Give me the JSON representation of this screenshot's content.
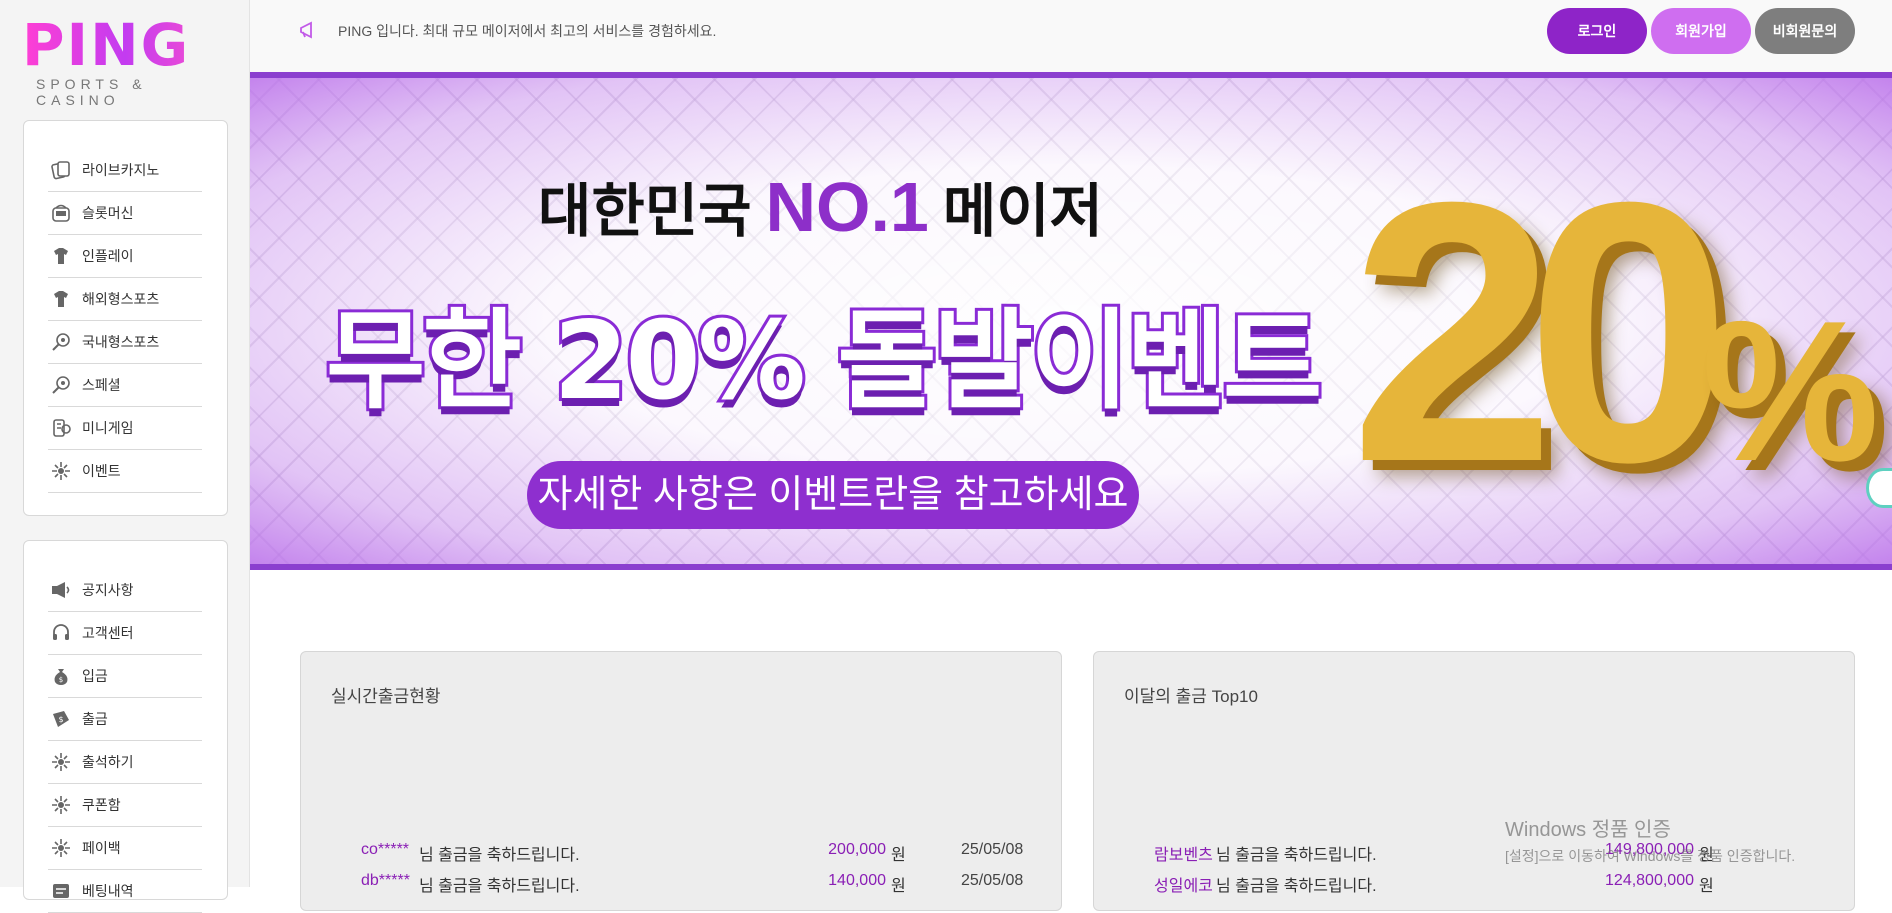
{
  "brand": {
    "logo": "PING",
    "tagline": "SPORTS & CASINO"
  },
  "sidebar": {
    "menu1": [
      {
        "label": "라이브카지노",
        "icon": "cards-icon"
      },
      {
        "label": "슬롯머신",
        "icon": "slot-machine-icon"
      },
      {
        "label": "인플레이",
        "icon": "sports-jersey-icon"
      },
      {
        "label": "해외형스포츠",
        "icon": "sports-jersey-icon"
      },
      {
        "label": "국내형스포츠",
        "icon": "sports-ball-icon"
      },
      {
        "label": "스페셜",
        "icon": "sports-ball-icon"
      },
      {
        "label": "미니게임",
        "icon": "minigame-icon"
      },
      {
        "label": "이벤트",
        "icon": "sparkle-icon"
      }
    ],
    "menu2": [
      {
        "label": "공지사항",
        "icon": "megaphone-icon"
      },
      {
        "label": "고객센터",
        "icon": "headset-icon"
      },
      {
        "label": "입금",
        "icon": "money-bag-icon"
      },
      {
        "label": "출금",
        "icon": "withdraw-icon"
      },
      {
        "label": "출석하기",
        "icon": "sparkle-icon"
      },
      {
        "label": "쿠폰함",
        "icon": "sparkle-icon"
      },
      {
        "label": "페이백",
        "icon": "sparkle-icon"
      },
      {
        "label": "베팅내역",
        "icon": "list-icon"
      }
    ]
  },
  "topbar": {
    "notice": "PING 입니다. 최대 규모 메이저에서 최고의 서비스를 경험하세요.",
    "login": "로그인",
    "join": "회원가입",
    "guest_inquiry": "비회원문의"
  },
  "banner": {
    "line1_pre": "대한민국",
    "line1_no1": "NO.1",
    "line1_post": "메이저",
    "line2": "무한 20% 돌발이벤트",
    "pill": "자세한 사항은 이벤트란을 참고하세요",
    "big_number": "20",
    "big_pct": "%"
  },
  "panels": {
    "realtime": {
      "title": "실시간출금현황",
      "rows": [
        {
          "user": "co*****",
          "msg": "님 출금을 축하드립니다.",
          "amount": "200,000",
          "unit": "원",
          "date": "25/05/08"
        },
        {
          "user": "db*****",
          "msg": "님 출금을 축하드립니다.",
          "amount": "140,000",
          "unit": "원",
          "date": "25/05/08"
        }
      ]
    },
    "top10": {
      "title": "이달의 출금 Top10",
      "rows": [
        {
          "user": "람보벤츠",
          "msg": "님 출금을 축하드립니다.",
          "amount": "149,800,000",
          "unit": "원"
        },
        {
          "user": "성일에코",
          "msg": "님 출금을 축하드립니다.",
          "amount": "124,800,000",
          "unit": "원"
        }
      ]
    }
  },
  "watermark": {
    "line1": "Windows 정품 인증",
    "line2": "[설정]으로 이동하여 Windows를 정품 인증합니다."
  },
  "colors": {
    "accent": "#8e24c8",
    "accent_light": "#cf6ef0",
    "gray_button": "#7e7e7e"
  }
}
